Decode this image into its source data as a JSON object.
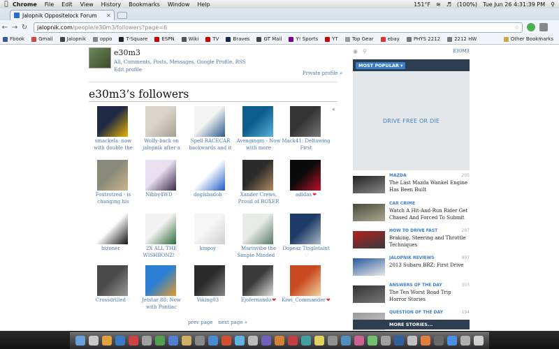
{
  "menubar": {
    "app": "Chrome",
    "items": [
      "File",
      "Edit",
      "View",
      "History",
      "Bookmarks",
      "Window",
      "Help"
    ],
    "status": {
      "temp": "151°F",
      "battery": "(100%)",
      "clock": "Tue Jun 26  4:31:39 PM"
    }
  },
  "browser": {
    "tab_title": "Jalopnik Oppositelock Forum",
    "url_domain": "jalopnik.com",
    "url_path": "/people/e30m3/followers?page=6",
    "bookmarks": [
      {
        "label": "Fbook",
        "color": "#3b5998"
      },
      {
        "label": "Gmail",
        "color": "#d44"
      },
      {
        "label": "Jalopnik",
        "color": "#444"
      },
      {
        "label": "oppo",
        "color": "#888"
      },
      {
        "label": "T-Square",
        "color": "#222"
      },
      {
        "label": "ESPN",
        "color": "#c00"
      },
      {
        "label": "Wiki",
        "color": "#555"
      },
      {
        "label": "TV",
        "color": "#c00"
      },
      {
        "label": "Braves",
        "color": "#13274f"
      },
      {
        "label": "GT Mail",
        "color": "#444"
      },
      {
        "label": "Y! Sports",
        "color": "#7b0099"
      },
      {
        "label": "YT",
        "color": "#c00"
      },
      {
        "label": "Top Gear",
        "color": "#999"
      },
      {
        "label": "ebay",
        "color": "#e53238"
      },
      {
        "label": "PHYS 2212",
        "color": "#777"
      },
      {
        "label": "2212 HW",
        "color": "#777"
      }
    ],
    "other_bookmarks": "Other Bookmarks"
  },
  "profile": {
    "username": "e30m3",
    "links": [
      "All",
      "Comments",
      "Posts",
      "Messages",
      "Google Profile",
      "RSS"
    ],
    "edit": "Edit profile",
    "private": "Private profile »",
    "followers_title": "e30m3’s followers",
    "prev_arrow": "«"
  },
  "followers": [
    {
      "label": "smackela: now with double the",
      "heart": "",
      "colors": [
        "#1f2a44",
        "#e8b400"
      ]
    },
    {
      "label": "Wolfy-back on jalopnik after a",
      "heart": "",
      "colors": [
        "#d9d4cc",
        "#a69e92"
      ]
    },
    {
      "label": "Spell RACECAR backwards and it",
      "heart": "",
      "colors": [
        "#f4f4f4",
        "#2d5a8a"
      ]
    },
    {
      "label": "Avengingm - Now with more",
      "heart": "",
      "colors": [
        "#0d5e8c",
        "#57b3d9"
      ]
    },
    {
      "label": "Mack41: Deltawing First",
      "heart": "",
      "colors": [
        "#333",
        "#777"
      ]
    },
    {
      "label": "Foxtrotred - is changing his",
      "heart": "",
      "colors": [
        "#8a8a7a",
        "#c9b58a"
      ]
    },
    {
      "label": "Nibby4WD",
      "heart": "grey",
      "colors": [
        "#e8e0f0",
        "#3a2a4a"
      ]
    },
    {
      "label": "dogisbadob",
      "heart": "grey",
      "colors": [
        "#ffffff",
        "#1e5bc6"
      ]
    },
    {
      "label": "Xander Crews, Proud of BOXER",
      "heart": "",
      "colors": [
        "#2b2b2b",
        "#b08a60"
      ]
    },
    {
      "label": "adidas",
      "heart": "red",
      "colors": [
        "#0a0a0a",
        "#c0102a"
      ]
    },
    {
      "label": "bizoner",
      "heart": "grey",
      "colors": [
        "#ffffff",
        "#111111"
      ]
    },
    {
      "label": "2X ALL THE WISHBONZ!",
      "heart": "grey",
      "colors": [
        "#f2f2f2",
        "#2f6b3a"
      ]
    },
    {
      "label": "kmpoy",
      "heart": "grey",
      "colors": [
        "#f6f6f6",
        "#cfcfcf"
      ]
    },
    {
      "label": "Marinvibe the Simple Minded",
      "heart": "grey",
      "colors": [
        "#e8ece8",
        "#5a7a6a"
      ]
    },
    {
      "label": "Dopeaz Tingletaint",
      "heart": "grey",
      "colors": [
        "#1e3a66",
        "#aab8c8"
      ]
    },
    {
      "label": "Crossdrilled",
      "heart": "grey",
      "colors": [
        "#4a4a4a",
        "#9a9a9a"
      ]
    },
    {
      "label": "Jetstar 88: Now with Pontiac",
      "heart": "",
      "colors": [
        "#2a7fd4",
        "#e09a2a"
      ]
    },
    {
      "label": "Viking03",
      "heart": "grey",
      "colors": [
        "#2a2a2a",
        "#888888"
      ]
    },
    {
      "label": "Ejofernando",
      "heart": "red",
      "colors": [
        "#3a3a3a",
        "#dcdcdc"
      ]
    },
    {
      "label": "Kiwi_Commander",
      "heart": "red",
      "colors": [
        "#c84a1e",
        "#f2d2a0"
      ]
    }
  ],
  "pager": {
    "prev": "prev page",
    "next": "next page »"
  },
  "sidebar": {
    "user_link": "E30M3",
    "popular": "MOST POPULAR ▾",
    "ad_text": "DRIVE FREE OR DIE",
    "stories": [
      {
        "category": "MAZDA",
        "count": "205",
        "headline": "The Last Mazda Wankel Engine Has Been Built",
        "colors": [
          "#222",
          "#888"
        ]
      },
      {
        "category": "CAR CRIME",
        "count": "",
        "headline": "Watch A Hit-And-Run Rider Get Chased And Forced To Submit",
        "colors": [
          "#4a4a3a",
          "#aaa890"
        ]
      },
      {
        "category": "HOW TO DRIVE FAST",
        "count": "287",
        "headline": "Braking, Steering and Throttle Techniques",
        "colors": [
          "#b02020",
          "#3a3a3a"
        ]
      },
      {
        "category": "JALOPNIK REVIEWS",
        "count": "997",
        "headline": "2013 Subaru BRZ: First Drive",
        "colors": [
          "#2a5aa0",
          "#e8e8e8"
        ]
      },
      {
        "category": "ANSWERS OF THE DAY",
        "count": "303",
        "headline": "The Ten Worst Road Trip Horror Stories",
        "colors": [
          "#333",
          "#777"
        ]
      },
      {
        "category": "QUESTION OF THE DAY",
        "count": "194",
        "headline": "",
        "colors": [
          "#999",
          "#ccc"
        ]
      }
    ],
    "more": "MORE STORIES..."
  }
}
